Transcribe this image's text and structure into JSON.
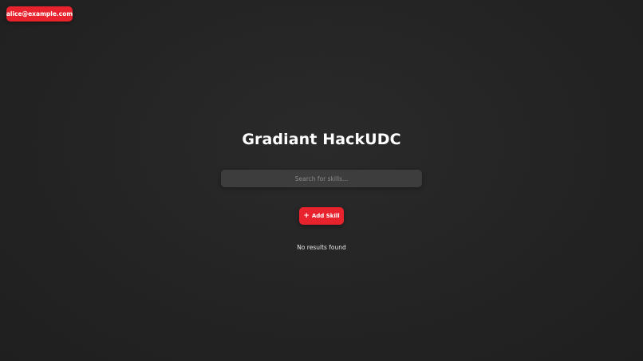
{
  "header": {
    "user_email": "alice@example.com"
  },
  "main": {
    "title": "Gradiant HackUDC",
    "search": {
      "value": "",
      "placeholder": "Search for skills..."
    },
    "add_button": {
      "icon": "plus-icon",
      "icon_glyph": "+",
      "label": "Add Skill"
    },
    "empty_message": "No results found"
  },
  "colors": {
    "accent": "#e8232e",
    "background": "#232323",
    "input_background": "#3d3d3d"
  }
}
